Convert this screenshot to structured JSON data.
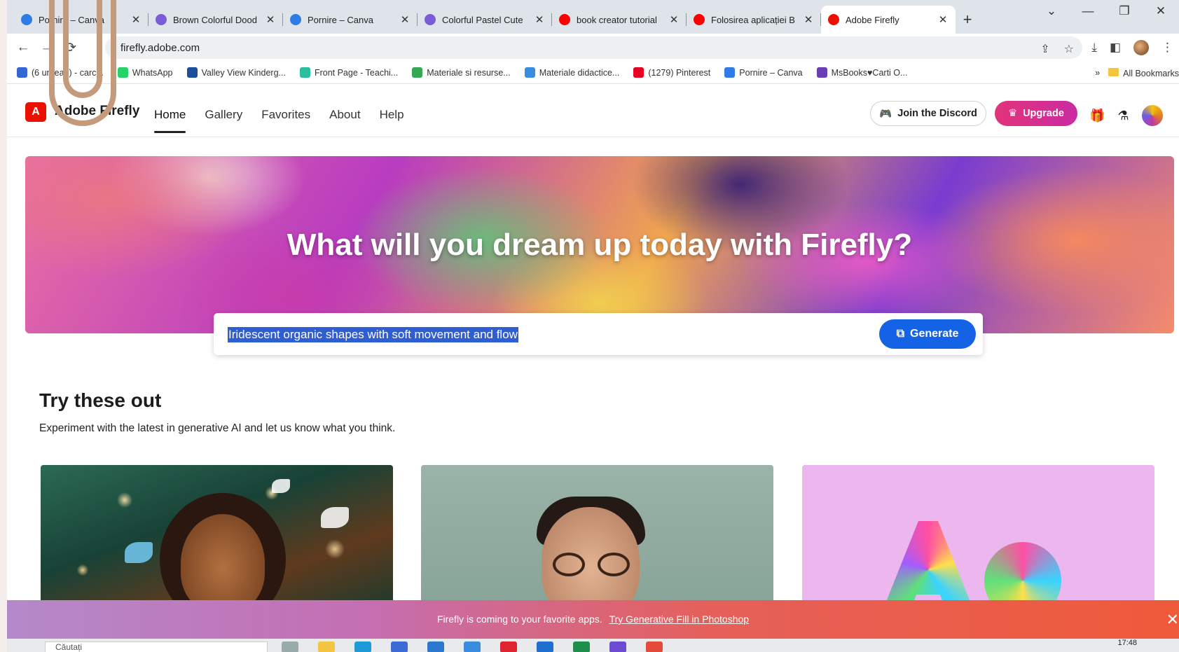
{
  "browser": {
    "tabs": [
      {
        "title": "Pornire – Canva",
        "active": false,
        "favicon_color": "#2f7be8"
      },
      {
        "title": "Brown Colorful Dood",
        "active": false,
        "favicon_color": "#7a5cd6"
      },
      {
        "title": "Pornire – Canva",
        "active": false,
        "favicon_color": "#2f7be8"
      },
      {
        "title": "Colorful Pastel Cute",
        "active": false,
        "favicon_color": "#7a5cd6"
      },
      {
        "title": "book creator tutorial",
        "active": false,
        "favicon_color": "#ff0000"
      },
      {
        "title": "Folosirea aplicației B",
        "active": false,
        "favicon_color": "#ff0000"
      },
      {
        "title": "Adobe Firefly",
        "active": true,
        "favicon_color": "#eb1000"
      }
    ],
    "new_tab": "+",
    "url": "firefly.adobe.com",
    "bookmarks": [
      {
        "label": "(6 unread) - carc...",
        "icon_color": "#3367d6"
      },
      {
        "label": "WhatsApp",
        "icon_color": "#25d366"
      },
      {
        "label": "Valley View Kinderg...",
        "icon_color": "#1b4f9c"
      },
      {
        "label": "Front Page - Teachi...",
        "icon_color": "#2bbf9f"
      },
      {
        "label": "Materiale si resurse...",
        "icon_color": "#36a853"
      },
      {
        "label": "Materiale didactice...",
        "icon_color": "#3a8ce0"
      },
      {
        "label": "(1279) Pinterest",
        "icon_color": "#e60023"
      },
      {
        "label": "Pornire – Canva",
        "icon_color": "#2f7be8"
      },
      {
        "label": "MsBooks♥Carti O...",
        "icon_color": "#6a3fb5"
      }
    ],
    "bookmarks_more": "»",
    "all_bookmarks": "All Bookmarks"
  },
  "firefly": {
    "brand": "Adobe Firefly",
    "menu": [
      {
        "label": "Home",
        "active": true
      },
      {
        "label": "Gallery",
        "active": false
      },
      {
        "label": "Favorites",
        "active": false
      },
      {
        "label": "About",
        "active": false
      },
      {
        "label": "Help",
        "active": false
      }
    ],
    "discord_label": "Join the Discord",
    "upgrade_label": "Upgrade",
    "hero_title": "What will you dream up today with Firefly?",
    "prompt_value": "Iridescent organic shapes with soft movement and flow",
    "generate_label": "Generate",
    "try_title": "Try these out",
    "try_subtitle": "Experiment with the latest in generative AI and let us know what you think.",
    "banner_text": "Firefly is coming to your favorite apps.",
    "banner_link": "Try Generative Fill in Photoshop"
  },
  "taskbar": {
    "search_placeholder": "Căutați",
    "clock": "17:48"
  },
  "colors": {
    "accent_blue": "#1463e6",
    "adobe_red": "#eb1000",
    "upgrade_pink": "#e2337a"
  }
}
